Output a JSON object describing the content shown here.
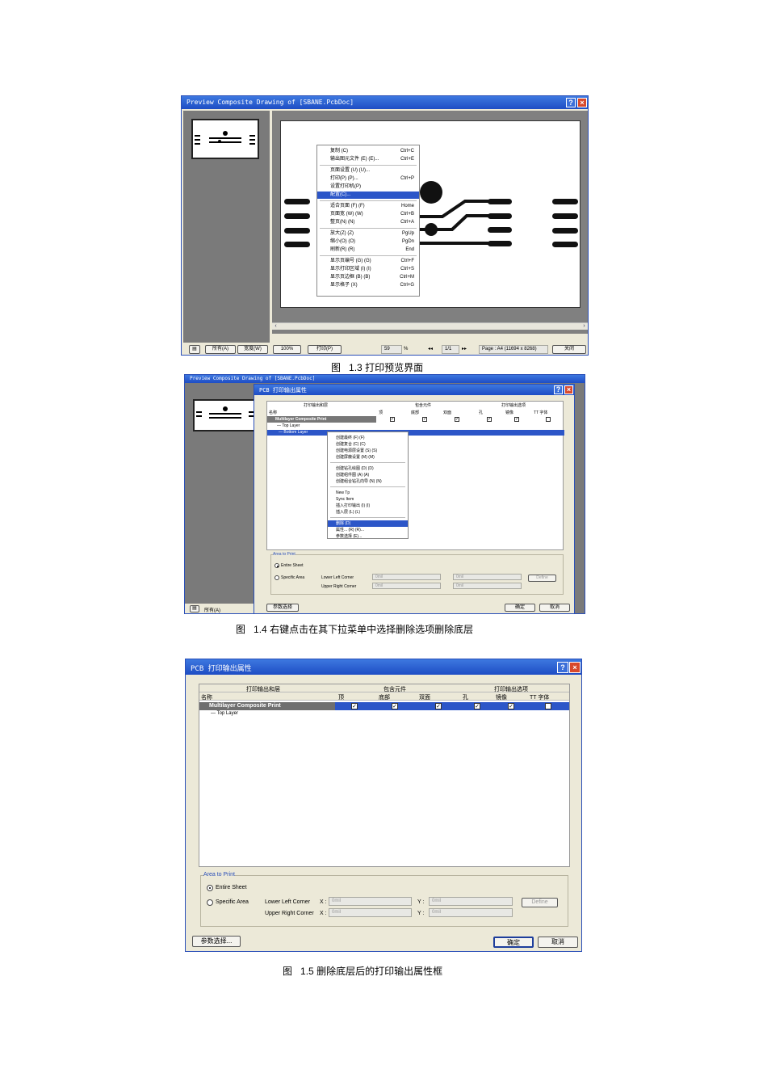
{
  "fig13": {
    "window_title": "Preview Composite Drawing of [SBANE.PcbDoc]",
    "context_menu": [
      {
        "label": "复制 (C)",
        "shortcut": "Ctrl+C"
      },
      {
        "label": "输出图元文件 (E) (E)...",
        "shortcut": "Ctrl+E"
      },
      {
        "label": "页面设置 (U) (U)...",
        "shortcut": ""
      },
      {
        "label": "打印(P) (P)...",
        "shortcut": "Ctrl+P"
      },
      {
        "label": "设置打印机(P)",
        "shortcut": ""
      },
      {
        "label": "配置(C)...",
        "shortcut": ""
      },
      {
        "label": "适合页面 (F) (F)",
        "shortcut": "Home"
      },
      {
        "label": "页面宽 (W) (W)",
        "shortcut": "Ctrl+B"
      },
      {
        "label": "整页(N) (N)",
        "shortcut": "Ctrl+A"
      },
      {
        "label": "放大(Z) (Z)",
        "shortcut": "PgUp"
      },
      {
        "label": "缩小(O) (O)",
        "shortcut": "PgDn"
      },
      {
        "label": "刷新(R) (R)",
        "shortcut": "End"
      },
      {
        "label": "显示页编号 (G) (G)",
        "shortcut": "Ctrl+F"
      },
      {
        "label": "显示打印区域 (I) (I)",
        "shortcut": "Ctrl+S"
      },
      {
        "label": "显示页边框 (B) (B)",
        "shortcut": "Ctrl+M"
      },
      {
        "label": "显示格子 (X)",
        "shortcut": "Ctrl+G"
      }
    ],
    "status": {
      "all_label": "所有(A)",
      "width_label": "宽度(W)",
      "zoom_btn": "100%",
      "print_btn": "打印(P)",
      "zoom_value": "59",
      "pct": "%",
      "page_value": "1/1",
      "page_info": "Page : A4 (11694 x 8268)",
      "close": "关闭"
    }
  },
  "caption13": {
    "prefix": "图",
    "num": "1.3",
    "text": "打印预览界面"
  },
  "fig14": {
    "window_title": "PCB 打印输出属性",
    "context_menu": [
      "创建最终 (F) (F)",
      "创建复合 (C) (C)",
      "创建电源层设置 (S) (S)",
      "创建屏蔽设置 (M) (M)",
      "创建钻孔绘图 (D) (D)",
      "创建组件图 (A) (A)",
      "创建组合钻孔向导 (N) (N)",
      "New Tp",
      "Sync Item",
      "插入打印输出 (I) (I)",
      "插入层 (L) (L)",
      "删除 (D)",
      "属性... (R) (R)...",
      "参数选择 (E)..."
    ],
    "bottom_btns": {
      "prefs": "参数选择",
      "ok": "确定",
      "cancel": "取消"
    }
  },
  "caption14": {
    "prefix": "图",
    "num": "1.4",
    "text": "右键点击在其下拉菜单中选择删除选项删除底层"
  },
  "dialog": {
    "title": "PCB 打印输出属性",
    "group_headers": {
      "layers": "打印输出和层",
      "components": "包含元件",
      "options": "打印输出选项"
    },
    "columns": {
      "name": "名称",
      "top": "顶",
      "bottom": "底部",
      "double": "双面",
      "holes": "孔",
      "mirror": "镜像",
      "tt": "TT 字体"
    },
    "rows": [
      {
        "name": "Multilayer Composite Print",
        "top": true,
        "bottom": true,
        "double": true,
        "holes": true,
        "mirror": true,
        "tt": false
      },
      {
        "name": "Top Layer"
      },
      {
        "name": "Bottom Layer"
      }
    ],
    "area": {
      "legend": "Area to Print",
      "entire_sheet": "Entire Sheet",
      "specific_area": "Specific Area",
      "lower_left": "Lower Left Corner",
      "upper_right": "Upper Right Corner",
      "x_label": "X :",
      "y_label": "Y :",
      "zero": "0mil",
      "define": "Define"
    },
    "buttons": {
      "prefs": "参数选择...",
      "ok": "确定",
      "cancel": "取消"
    }
  },
  "caption15": {
    "prefix": "图",
    "num": "1.5",
    "text": "删除底层后的打印输出属性框"
  }
}
